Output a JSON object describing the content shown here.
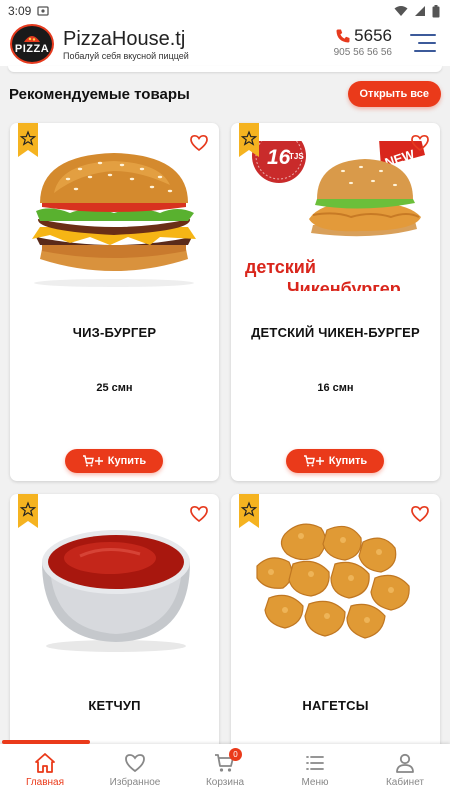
{
  "status": {
    "time": "3:09"
  },
  "header": {
    "brand_name": "PizzaHouse.tj",
    "slogan": "Побалуй себя вкусной пиццей",
    "logo_text": "PIZZA",
    "phone_short": "5656",
    "phone_full": "905 56 56 56"
  },
  "section": {
    "title": "Рекомендуемые товары",
    "open_all": "Открыть все"
  },
  "products": [
    {
      "title": "ЧИЗ-БУРГЕР",
      "price": "25 смн",
      "buy_label": "Купить"
    },
    {
      "title": "ДЕТСКИЙ ЧИКЕН-БУРГЕР",
      "price": "16 смн",
      "buy_label": "Купить",
      "promo": {
        "price_tag": "16",
        "currency": "TJS",
        "new_label": "NEW",
        "line1": "детский",
        "line2": "Чикенбургер"
      }
    },
    {
      "title": "КЕТЧУП"
    },
    {
      "title": "НАГЕТСЫ"
    }
  ],
  "nav": {
    "items": [
      {
        "label": "Главная",
        "icon": "home-icon"
      },
      {
        "label": "Избранное",
        "icon": "heart-icon"
      },
      {
        "label": "Корзина",
        "icon": "cart-icon",
        "badge": "0"
      },
      {
        "label": "Меню",
        "icon": "menu-list-icon"
      },
      {
        "label": "Кабинет",
        "icon": "user-icon"
      }
    ]
  },
  "colors": {
    "accent": "#ea3a1a",
    "badge": "#f5b320",
    "menu_icon": "#3c5a9a"
  }
}
